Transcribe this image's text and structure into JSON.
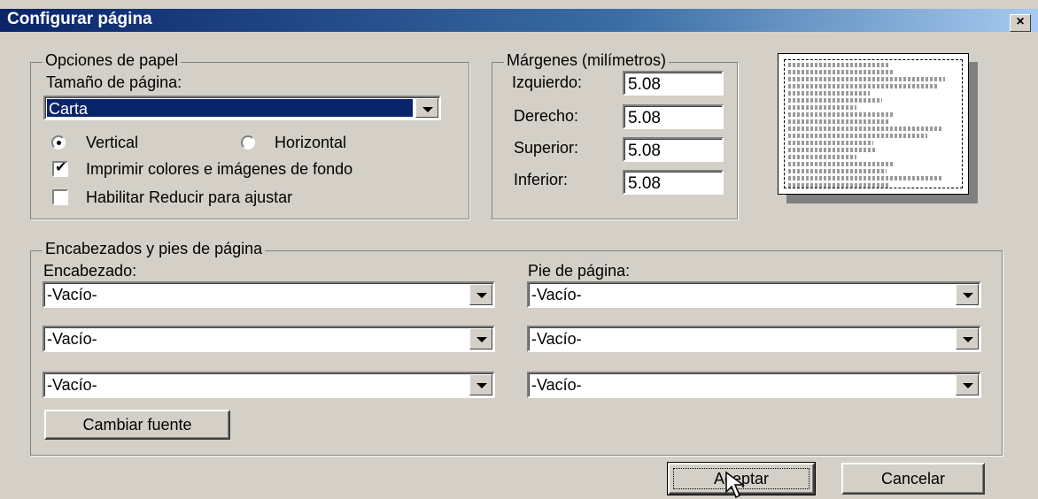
{
  "window": {
    "title": "Configurar página",
    "close_glyph": "×"
  },
  "paper_options": {
    "legend": "Opciones de papel",
    "page_size_label": "Tamaño de página:",
    "page_size_value": "Carta",
    "orientation_portrait": "Vertical",
    "orientation_landscape": "Horizontal",
    "orientation_selected": "portrait",
    "print_background_label": "Imprimir colores e imágenes de fondo",
    "print_background_checked": true,
    "shrink_to_fit_label": "Habilitar Reducir para ajustar",
    "shrink_to_fit_checked": false
  },
  "margins": {
    "legend": "Márgenes (milímetros)",
    "left_label": "Izquierdo:",
    "left_value": "5.08",
    "right_label": "Derecho:",
    "right_value": "5.08",
    "top_label": "Superior:",
    "top_value": "5.08",
    "bottom_label": "Inferior:",
    "bottom_value": "5.08"
  },
  "headers_footers": {
    "legend": "Encabezados y pies de página",
    "header_label": "Encabezado:",
    "footer_label": "Pie de página:",
    "header_values": [
      "-Vacío-",
      "-Vacío-",
      "-Vacío-"
    ],
    "footer_values": [
      "-Vacío-",
      "-Vacío-",
      "-Vacío-"
    ],
    "change_font_label": "Cambiar fuente"
  },
  "buttons": {
    "ok_label": "Aceptar",
    "cancel_label": "Cancelar"
  },
  "colors": {
    "title_bar": "#0a246a",
    "dialog_face": "#d4d0c8",
    "selection": "#0a246a"
  },
  "icons": {
    "close": "close-icon",
    "dropdown": "chevron-down-icon",
    "cursor": "mouse-pointer-icon"
  }
}
